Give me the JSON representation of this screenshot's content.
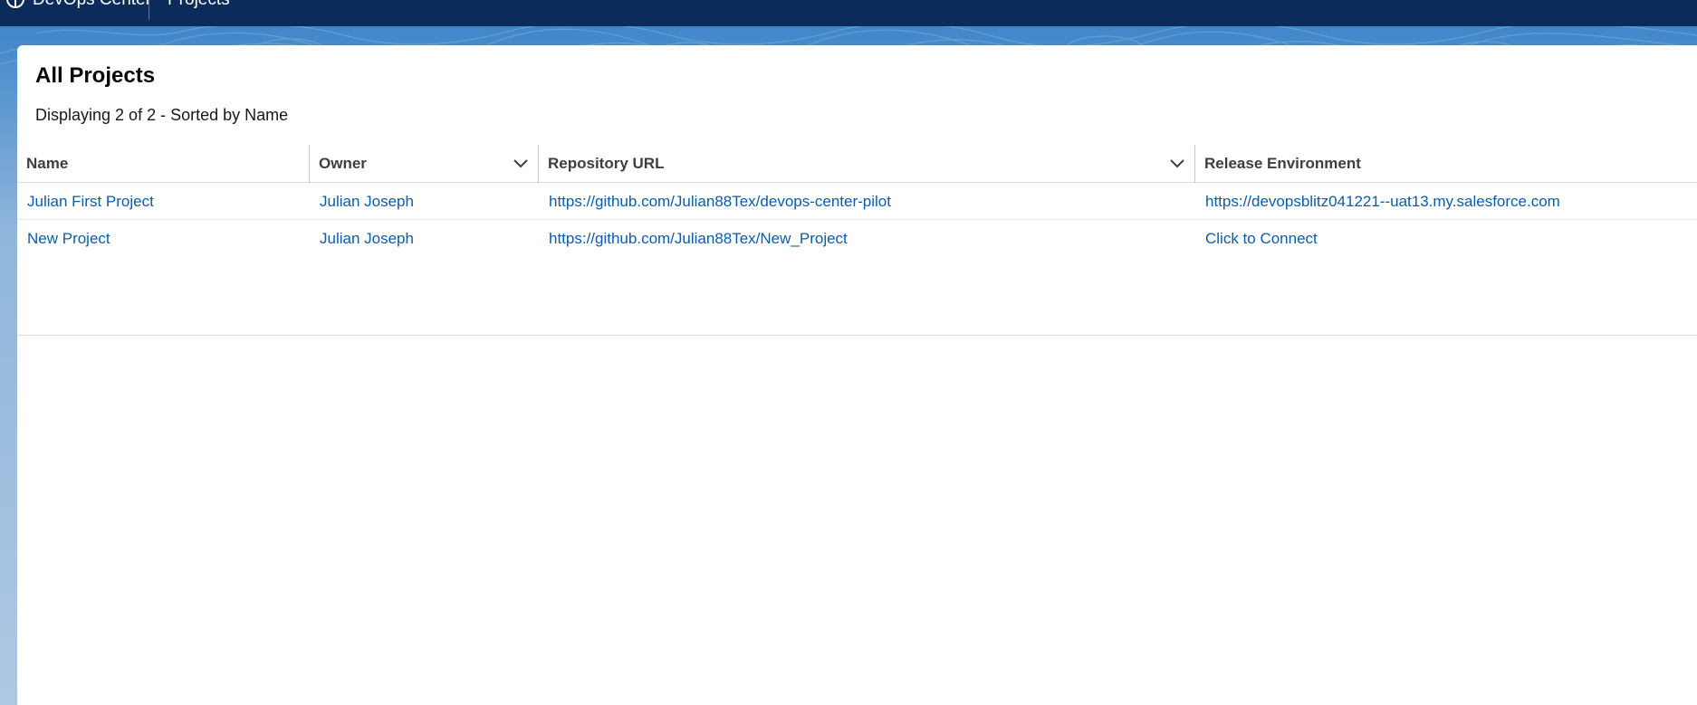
{
  "app": {
    "name": "DevOps Center",
    "nav_tab": "Projects"
  },
  "list": {
    "title": "All Projects",
    "summary": "Displaying 2 of 2 - Sorted by Name"
  },
  "table": {
    "columns": [
      {
        "label": "Name"
      },
      {
        "label": "Owner"
      },
      {
        "label": "Repository URL"
      },
      {
        "label": "Release Environment"
      }
    ],
    "rows": [
      {
        "name": "Julian First Project",
        "owner": "Julian Joseph",
        "repo": "https://github.com/Julian88Tex/devops-center-pilot",
        "release_env": "https://devopsblitz041221--uat13.my.salesforce.com"
      },
      {
        "name": "New Project",
        "owner": "Julian Joseph",
        "repo": "https://github.com/Julian88Tex/New_Project",
        "release_env": "Click to Connect"
      }
    ]
  },
  "colors": {
    "header_bg": "#0b2b5b",
    "link": "#0b5cab",
    "backdrop": "#8fb6dc"
  },
  "icons": {
    "app": "devops-center-icon",
    "column_menu": "chevron-down-icon"
  }
}
